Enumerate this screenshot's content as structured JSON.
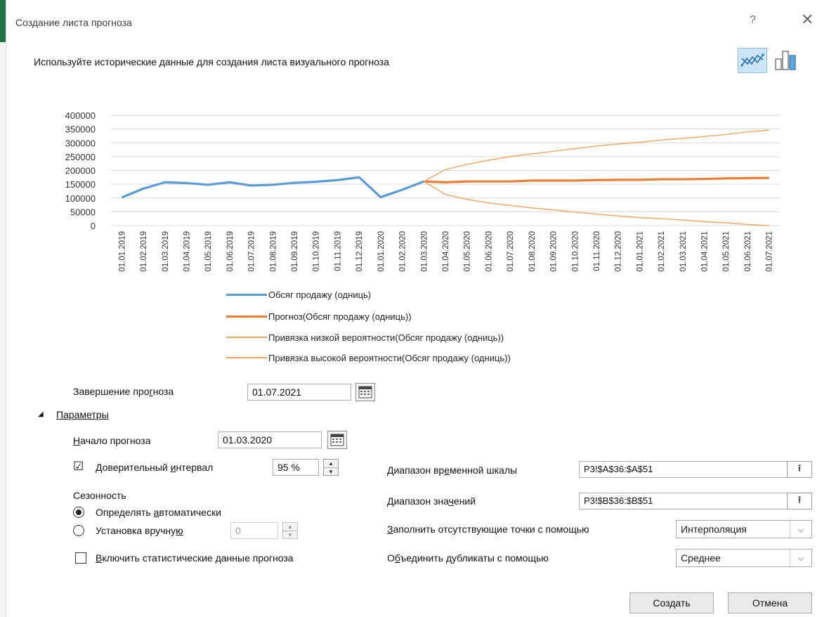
{
  "dialog": {
    "title": "Создание листа прогноза",
    "help": "?",
    "close": "✕",
    "subtitle": "Используйте исторические данные для создания листа визуального прогноза"
  },
  "colors": {
    "history": "#5b9bd5",
    "forecast": "#ed7d31",
    "bound": "#f4a460"
  },
  "chart_data": {
    "type": "line",
    "categories": [
      "01.01.2019",
      "01.02.2019",
      "01.03.2019",
      "01.04.2019",
      "01.05.2019",
      "01.06.2019",
      "01.07.2019",
      "01.08.2019",
      "01.09.2019",
      "01.10.2019",
      "01.11.2019",
      "01.12.2019",
      "01.01.2020",
      "01.02.2020",
      "01.03.2020",
      "01.04.2020",
      "01.05.2020",
      "01.06.2020",
      "01.07.2020",
      "01.08.2020",
      "01.09.2020",
      "01.10.2020",
      "01.11.2020",
      "01.12.2020",
      "01.01.2021",
      "01.02.2021",
      "01.03.2021",
      "01.04.2021",
      "01.05.2021",
      "01.06.2021",
      "01.07.2021"
    ],
    "yticks": [
      "400000",
      "350000",
      "300000",
      "250000",
      "200000",
      "150000",
      "100000",
      "50000",
      "0"
    ],
    "ylim": [
      0,
      400000
    ],
    "grid": true,
    "legend_position": "bottom",
    "series": [
      {
        "name": "Обсяг продажу (одниць)",
        "role": "history",
        "values": [
          102000,
          134000,
          157000,
          154000,
          148000,
          157000,
          145000,
          148000,
          155000,
          159000,
          165000,
          175000,
          103000,
          130000,
          160000,
          null,
          null,
          null,
          null,
          null,
          null,
          null,
          null,
          null,
          null,
          null,
          null,
          null,
          null,
          null,
          null
        ]
      },
      {
        "name": "Прогноз(Обсяг продажу (одниць))",
        "role": "forecast",
        "values": [
          null,
          null,
          null,
          null,
          null,
          null,
          null,
          null,
          null,
          null,
          null,
          null,
          null,
          null,
          160000,
          157000,
          160000,
          160000,
          160000,
          163000,
          163000,
          163000,
          165000,
          166000,
          166000,
          168000,
          168000,
          169000,
          171000,
          172000,
          173000
        ]
      },
      {
        "name": "Привязка низкой вероятности(Обсяг продажу (одниць))",
        "role": "lower",
        "values": [
          null,
          null,
          null,
          null,
          null,
          null,
          null,
          null,
          null,
          null,
          null,
          null,
          null,
          null,
          160000,
          113000,
          95000,
          82000,
          73000,
          64000,
          57000,
          49000,
          42000,
          35000,
          29000,
          25000,
          20000,
          14000,
          10000,
          4000,
          0
        ]
      },
      {
        "name": "Привязка высокой вероятности(Обсяг продажу (одниць))",
        "role": "upper",
        "values": [
          null,
          null,
          null,
          null,
          null,
          null,
          null,
          null,
          null,
          null,
          null,
          null,
          null,
          null,
          160000,
          203000,
          222000,
          237000,
          250000,
          260000,
          269000,
          279000,
          288000,
          296000,
          302000,
          310000,
          316000,
          323000,
          330000,
          340000,
          346000
        ]
      }
    ]
  },
  "form": {
    "end_label_pre": "Завершение про",
    "end_label_u": "г",
    "end_label_post": "ноза",
    "end_value": "01.07.2021",
    "params_toggle": "◢",
    "params_label": "Параметры",
    "start_label_u": "Н",
    "start_label_post": "ачало прогноза",
    "start_value": "01.03.2020",
    "ci_check": "☑",
    "ci_label_pre": "Доверительный ",
    "ci_label_u": "и",
    "ci_label_post": "нтервал",
    "ci_value": "95 %",
    "season_label": "Сезонность",
    "auto_label_pre": "Определять ",
    "auto_label_u": "а",
    "auto_label_post": "втоматически",
    "manual_label_pre": "Установка вручну",
    "manual_label_u": "ю",
    "manual_value": "0",
    "stats_label_u": "В",
    "stats_label_post": "ключить статистические данные прогноза",
    "timeline_label_pre": "Диапазон вр",
    "timeline_label_u": "е",
    "timeline_label_post": "менной шкалы",
    "timeline_value": "Р3!$A$36:$A$51",
    "values_label_pre": "Диапазон зна",
    "values_label_u": "ч",
    "values_label_post": "ений",
    "values_value": "Р3!$B$36:$B$51",
    "fill_label_u": "З",
    "fill_label_post": "аполнить отсутствующие точки с помощью",
    "fill_value": "Интерполяция",
    "dup_label_pre": "О",
    "dup_label_u": "б",
    "dup_label_post": "ъединить дубликаты с помощью",
    "dup_value": "Среднее",
    "ref_icon": "⭱",
    "dropdown_icon": "⌵",
    "create_label": "Создать",
    "cancel_label": "Отмена"
  }
}
